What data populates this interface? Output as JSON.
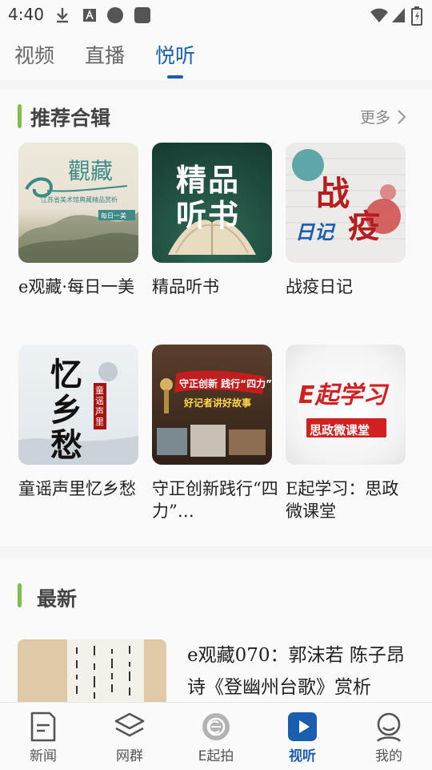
{
  "status_bar": {
    "time": "4:40"
  },
  "tabs": [
    {
      "label": "视频"
    },
    {
      "label": "直播"
    },
    {
      "label": "悦听"
    }
  ],
  "recommend": {
    "title": "推荐合辑",
    "more": "更多",
    "items": [
      {
        "title": "e观藏·每日一美",
        "thumb_text": "觀藏",
        "thumb_sub": "江苏省美术馆典藏精品赏析",
        "thumb_tag": "每日一美"
      },
      {
        "title": "精品听书",
        "thumb_text1": "精品",
        "thumb_text2": "听书"
      },
      {
        "title": "战疫日记",
        "thumb_text1": "战",
        "thumb_text2": "疫",
        "thumb_text3": "日记"
      },
      {
        "title": "童谣声里忆乡愁",
        "thumb_text": "忆乡愁",
        "thumb_tag": "童谣声里"
      },
      {
        "title": "守正创新践行“四力”…",
        "thumb_text1": "守正创新 践行“四力”",
        "thumb_text2": "好记者讲好故事"
      },
      {
        "title": "E起学习：思政微课堂",
        "thumb_text1": "E起学习",
        "thumb_text2": "思政微课堂"
      }
    ]
  },
  "latest": {
    "title": "最新",
    "items": [
      {
        "title": "e观藏070：郭沫若 陈子昂诗《登幽州台歌》赏析"
      }
    ]
  },
  "bottom_nav": [
    {
      "label": "新闻",
      "icon": "news-icon"
    },
    {
      "label": "网群",
      "icon": "layers-icon"
    },
    {
      "label": "E起拍",
      "icon": "camera-e-icon"
    },
    {
      "label": "视听",
      "icon": "play-icon"
    },
    {
      "label": "我的",
      "icon": "profile-icon"
    }
  ],
  "colors": {
    "accent": "#1a5eb0",
    "section_bar": "#7cc04a"
  }
}
